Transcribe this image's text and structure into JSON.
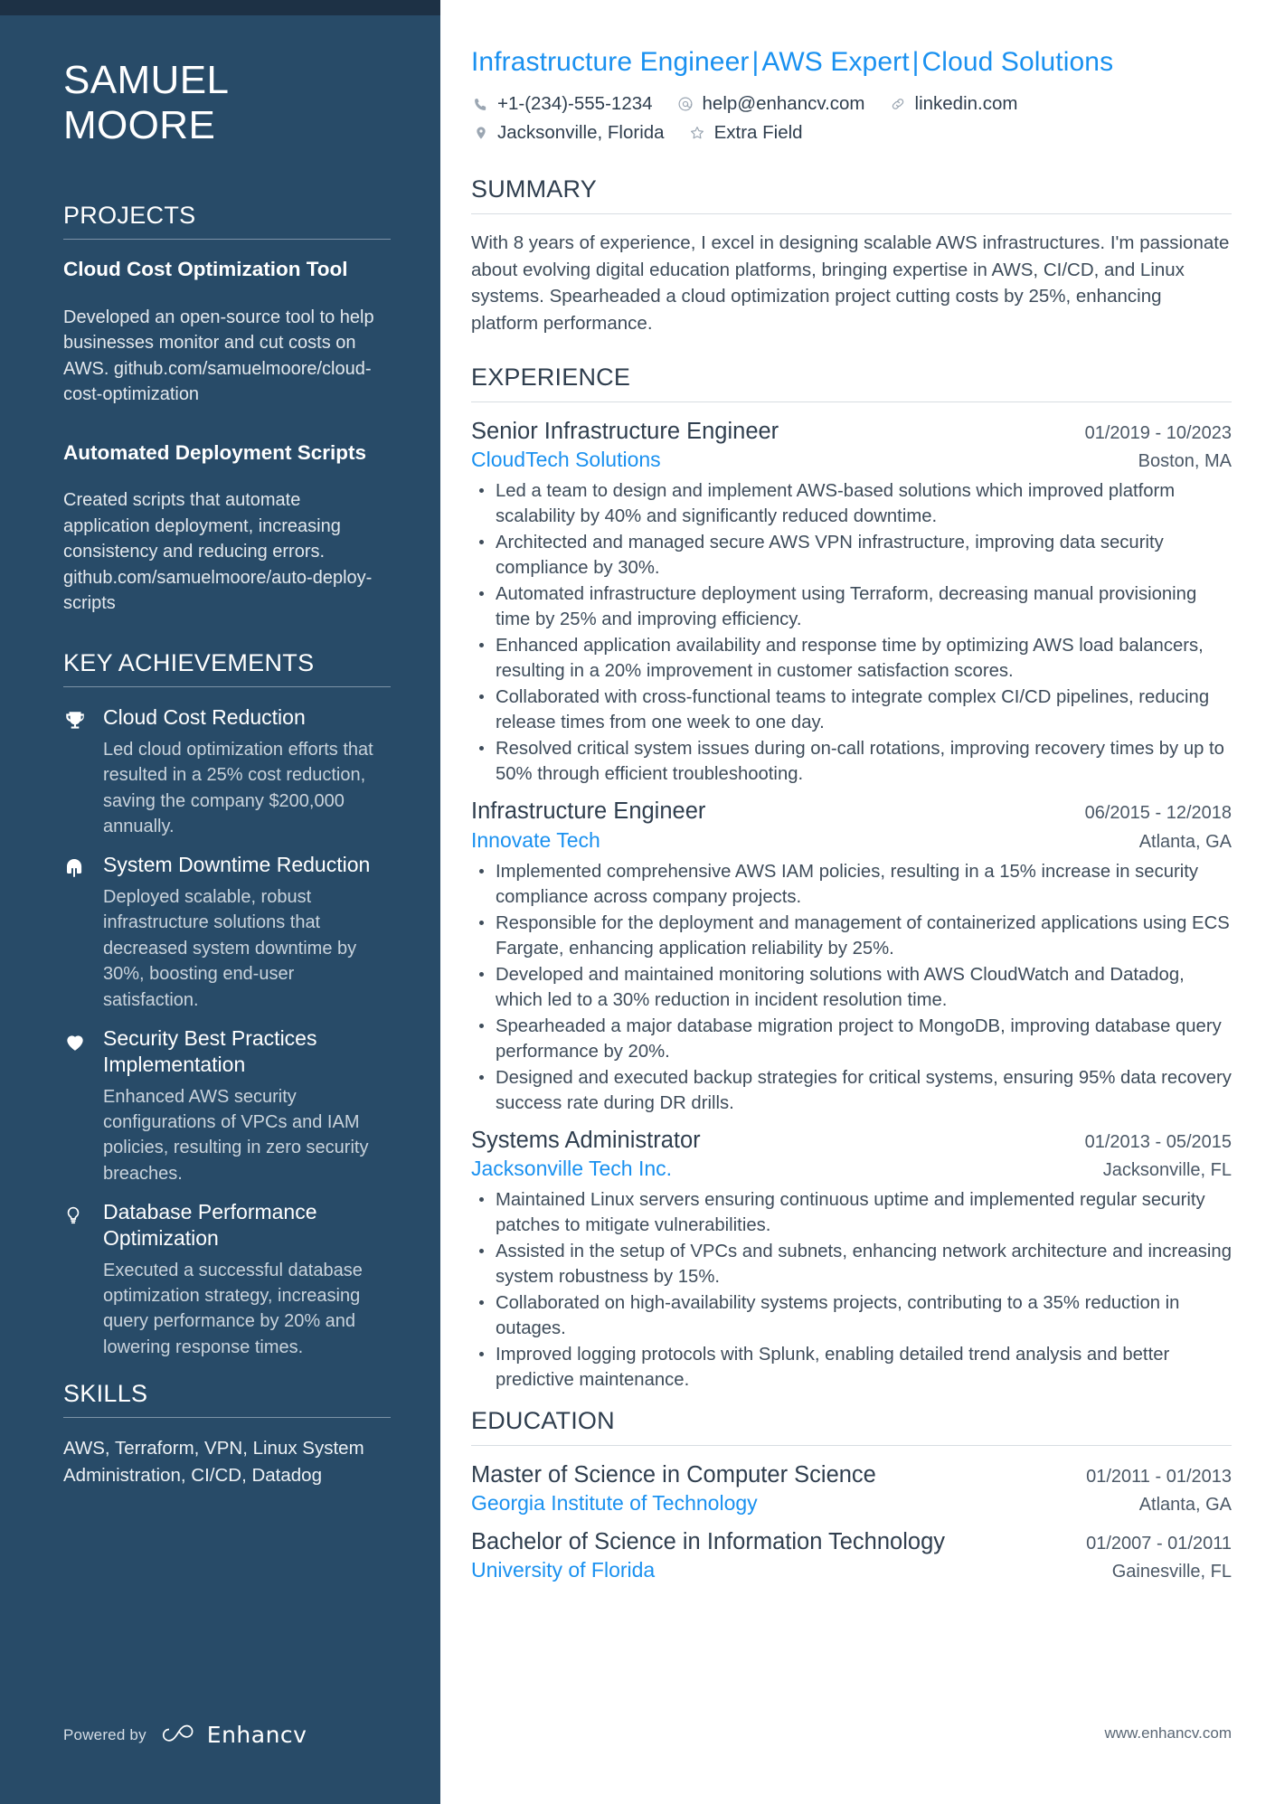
{
  "colors": {
    "sidebar_bg": "#284B68",
    "sidebar_topbar": "#1D3145",
    "accent_blue": "#1A91F0",
    "body_text": "#3E4C5A",
    "heading_text": "#2F3E4E"
  },
  "sidebar": {
    "name_line1": "SAMUEL",
    "name_line2": "MOORE",
    "projects": {
      "title": "PROJECTS",
      "items": [
        {
          "name": "Cloud Cost Optimization Tool",
          "description": "Developed an open-source tool to help businesses monitor and cut costs on AWS. github.com/samuelmoore/cloud-cost-optimization"
        },
        {
          "name": "Automated Deployment Scripts",
          "description": "Created scripts that automate application deployment, increasing consistency and reducing errors. github.com/samuelmoore/auto-deploy-scripts"
        }
      ]
    },
    "key_achievements": {
      "title": "KEY ACHIEVEMENTS",
      "items": [
        {
          "icon": "trophy-icon",
          "title": "Cloud Cost Reduction",
          "description": "Led cloud optimization efforts that resulted in a 25% cost reduction, saving the company $200,000 annually."
        },
        {
          "icon": "helmet-icon",
          "title": "System Downtime Reduction",
          "description": "Deployed scalable, robust infrastructure solutions that decreased system downtime by 30%, boosting end-user satisfaction."
        },
        {
          "icon": "heart-icon",
          "title": "Security Best Practices Implementation",
          "description": "Enhanced AWS security configurations of VPCs and IAM policies, resulting in zero security breaches."
        },
        {
          "icon": "lightbulb-icon",
          "title": "Database Performance Optimization",
          "description": "Executed a successful database optimization strategy, increasing query performance by 20% and lowering response times."
        }
      ]
    },
    "skills": {
      "title": "SKILLS",
      "text": "AWS, Terraform, VPN, Linux System Administration, CI/CD, Datadog"
    },
    "footer": {
      "powered_by": "Powered by",
      "brand": "Enhancv"
    }
  },
  "main": {
    "headline_parts": [
      "Infrastructure Engineer",
      "AWS Expert",
      "Cloud Solutions"
    ],
    "headline_separator": "|",
    "contact": {
      "row1": [
        {
          "icon": "phone-icon",
          "value": "+1-(234)-555-1234"
        },
        {
          "icon": "email-icon",
          "value": "help@enhancv.com"
        },
        {
          "icon": "link-icon",
          "value": "linkedin.com"
        }
      ],
      "row2": [
        {
          "icon": "location-pin-icon",
          "value": "Jacksonville, Florida"
        },
        {
          "icon": "star-icon",
          "value": "Extra Field"
        }
      ]
    },
    "summary": {
      "title": "SUMMARY",
      "text": "With 8 years of experience, I excel in designing scalable AWS infrastructures. I'm passionate about evolving digital education platforms, bringing expertise in AWS, CI/CD, and Linux systems. Spearheaded a cloud optimization project cutting costs by 25%, enhancing platform performance."
    },
    "experience": {
      "title": "EXPERIENCE",
      "jobs": [
        {
          "title": "Senior Infrastructure Engineer",
          "dates": "01/2019 - 10/2023",
          "company": "CloudTech Solutions",
          "location": "Boston, MA",
          "bullets": [
            "Led a team to design and implement AWS-based solutions which improved platform scalability by 40% and significantly reduced downtime.",
            "Architected and managed secure AWS VPN infrastructure, improving data security compliance by 30%.",
            "Automated infrastructure deployment using Terraform, decreasing manual provisioning time by 25% and improving efficiency.",
            "Enhanced application availability and response time by optimizing AWS load balancers, resulting in a 20% improvement in customer satisfaction scores.",
            "Collaborated with cross-functional teams to integrate complex CI/CD pipelines, reducing release times from one week to one day.",
            "Resolved critical system issues during on-call rotations, improving recovery times by up to 50% through efficient troubleshooting."
          ]
        },
        {
          "title": "Infrastructure Engineer",
          "dates": "06/2015 - 12/2018",
          "company": "Innovate Tech",
          "location": "Atlanta, GA",
          "bullets": [
            "Implemented comprehensive AWS IAM policies, resulting in a 15% increase in security compliance across company projects.",
            "Responsible for the deployment and management of containerized applications using ECS Fargate, enhancing application reliability by 25%.",
            "Developed and maintained monitoring solutions with AWS CloudWatch and Datadog, which led to a 30% reduction in incident resolution time.",
            "Spearheaded a major database migration project to MongoDB, improving database query performance by 20%.",
            "Designed and executed backup strategies for critical systems, ensuring 95% data recovery success rate during DR drills."
          ]
        },
        {
          "title": "Systems Administrator",
          "dates": "01/2013 - 05/2015",
          "company": "Jacksonville Tech Inc.",
          "location": "Jacksonville, FL",
          "bullets": [
            "Maintained Linux servers ensuring continuous uptime and implemented regular security patches to mitigate vulnerabilities.",
            "Assisted in the setup of VPCs and subnets, enhancing network architecture and increasing system robustness by 15%.",
            "Collaborated on high-availability systems projects, contributing to a 35% reduction in outages.",
            "Improved logging protocols with Splunk, enabling detailed trend analysis and better predictive maintenance."
          ]
        }
      ]
    },
    "education": {
      "title": "EDUCATION",
      "items": [
        {
          "degree": "Master of Science in Computer Science",
          "dates": "01/2011 - 01/2013",
          "school": "Georgia Institute of Technology",
          "location": "Atlanta, GA"
        },
        {
          "degree": "Bachelor of Science in Information Technology",
          "dates": "01/2007 - 01/2011",
          "school": "University of Florida",
          "location": "Gainesville, FL"
        }
      ]
    },
    "footer_url": "www.enhancv.com"
  }
}
